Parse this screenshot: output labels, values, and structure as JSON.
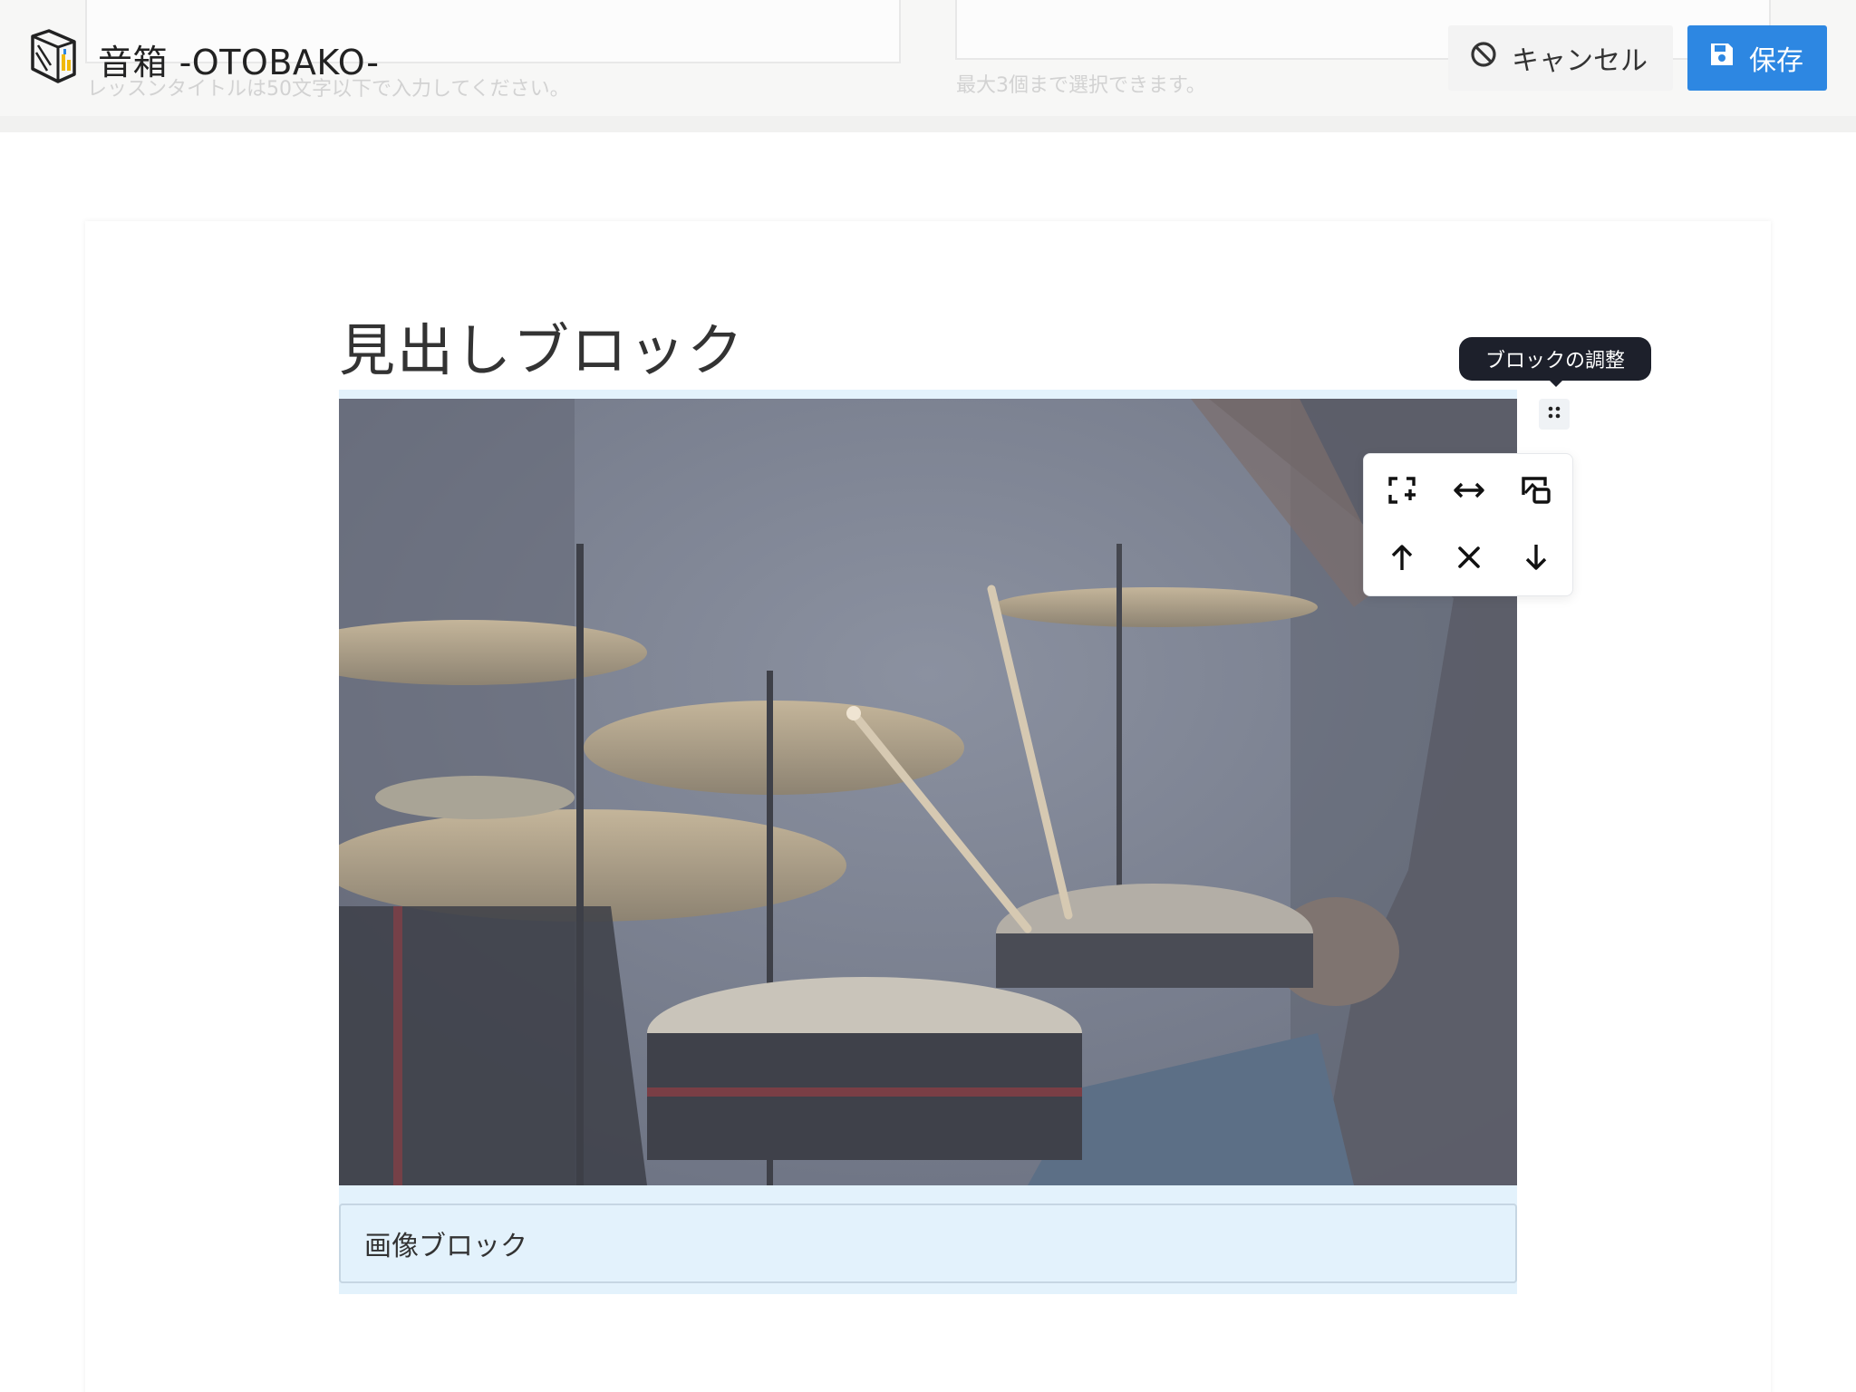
{
  "header": {
    "app_title": "音箱 -OTOBAKO-",
    "title_help": "レッスンタイトルは50文字以下で入力してください。",
    "tags_help": "最大3個まで選択できます。",
    "cancel_label": "キャンセル",
    "save_label": "保存",
    "colors": {
      "save_button": "#2d87e2",
      "cancel_button": "#f3f3f3"
    }
  },
  "editor": {
    "heading_block": "見出しブロック",
    "image_caption": "画像ブロック",
    "tooltip": "ブロックの調整",
    "tools": {
      "row1": [
        "add-block-icon",
        "stretch-width-icon",
        "image-background-icon"
      ],
      "row2": [
        "move-up-icon",
        "delete-icon",
        "move-down-icon"
      ]
    },
    "colors": {
      "selection": "#e3f2fc",
      "tooltip": "#1d202b"
    }
  }
}
